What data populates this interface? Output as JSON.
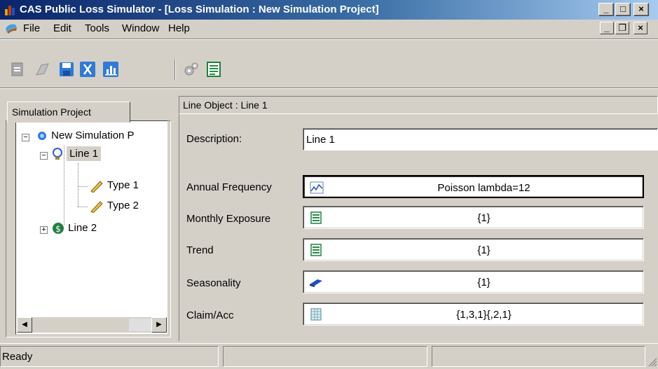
{
  "window": {
    "title": "CAS Public Loss Simulator - [Loss Simulation : New Simulation Project]",
    "buttons": {
      "minimize": "_",
      "maximize": "□",
      "close": "×"
    }
  },
  "menu": {
    "items": [
      "File",
      "Edit",
      "Tools",
      "Window",
      "Help"
    ],
    "mdi_buttons": {
      "minimize": "_",
      "restore": "❐",
      "close": "×"
    }
  },
  "toolbar": {
    "icons": [
      "new-document-icon",
      "open-icon",
      "save-icon",
      "cut-icon",
      "chart-icon",
      "gears-icon",
      "export-sheet-icon"
    ]
  },
  "left_pane": {
    "tab_label": "Simulation Project",
    "tree": [
      {
        "label": "New Simulation P",
        "icon": "gear-icon",
        "expander": "−"
      },
      {
        "label": "Line 1",
        "icon": "lightbulb-icon",
        "expander": "−",
        "selected": true
      },
      {
        "label": "Type 1",
        "icon": "pencil-icon"
      },
      {
        "label": "Type 2",
        "icon": "pencil-icon"
      },
      {
        "label": "Line 2",
        "icon": "dollar-icon",
        "expander": "+"
      }
    ]
  },
  "right_pane": {
    "header": "Line Object : Line 1",
    "description_label": "Description:",
    "description_value": "Line 1",
    "rows": [
      {
        "label": "Annual Frequency",
        "value": "Poisson lambda=12",
        "icon": "chart-icon"
      },
      {
        "label": "Monthly Exposure",
        "value": "{1}",
        "icon": "sheet-icon"
      },
      {
        "label": "Trend",
        "value": "{1}",
        "icon": "sheet-icon"
      },
      {
        "label": "Seasonality",
        "value": "{1}",
        "icon": "book-icon"
      },
      {
        "label": "Claim/Acc",
        "value": "{1,3,1}{,2,1}",
        "icon": "grid-icon"
      }
    ]
  },
  "status": {
    "text": "Ready"
  }
}
